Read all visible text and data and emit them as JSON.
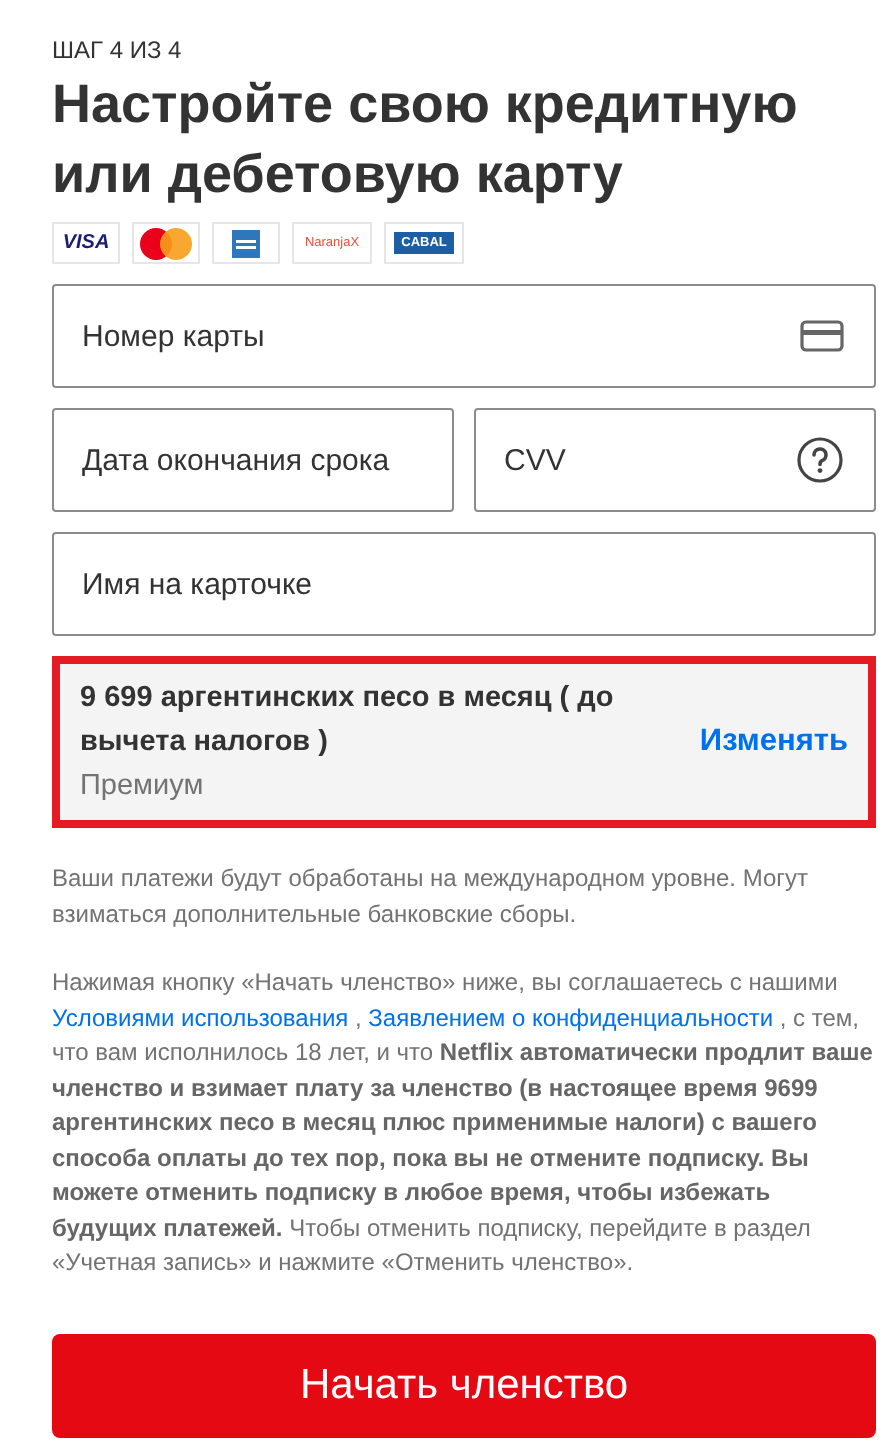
{
  "step": "ШАГ 4 ИЗ 4",
  "title": "Настройте свою кредитную или дебетовую карту",
  "card_logos": [
    {
      "kind": "visa",
      "text": "VISA"
    },
    {
      "kind": "mastercard"
    },
    {
      "kind": "amex"
    },
    {
      "kind": "naranja",
      "text": "NaranjaX"
    },
    {
      "kind": "cabal",
      "text": "CABAL"
    }
  ],
  "fields": [
    {
      "kind": "card",
      "placeholder": "Номер карты"
    },
    {
      "kind": "plain",
      "placeholder": "Дата окончания срока"
    },
    {
      "kind": "cvv",
      "placeholder": "CVV"
    },
    {
      "kind": "plain",
      "placeholder": "Имя на карточке"
    }
  ],
  "plan": {
    "price": "9 699 аргентинских песо в месяц ( до вычета налогов )",
    "name": "Премиум",
    "change": "Изменять"
  },
  "note": "Ваши платежи будут обработаны на международном уровне. Могут взиматься дополнительные банковские сборы.",
  "legal": [
    {
      "kind": "text",
      "text": "Нажимая кнопку «Начать членство» ниже, вы соглашаетесь с нашими "
    },
    {
      "kind": "link",
      "text": "Условиями использования"
    },
    {
      "kind": "text",
      "text": " , "
    },
    {
      "kind": "link",
      "text": "Заявлением о конфиденциальности"
    },
    {
      "kind": "text",
      "text": " , с тем, что вам исполнилось 18 лет, и что **Netflix автоматически продлит ваше членство и взимает плату за членство (в настоящее время 9699 аргентинских песо в месяц плюс применимые налоги) с вашего способа оплаты до тех пор, пока вы не отмените подписку. Вы можете отменить подписку в любое время, чтобы избежать будущих платежей.** Чтобы отменить подписку, перейдите в раздел «Учетная запись» и нажмите «Отменить членство»."
    }
  ],
  "submit": "Начать членство"
}
